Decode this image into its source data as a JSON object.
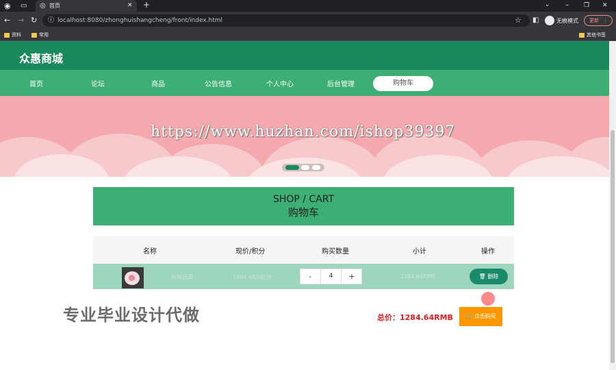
{
  "browser": {
    "tab_title": "首页",
    "url": "localhost:8080/zhonghuishangcheng/front/index.html",
    "profile_label": "无痕模式",
    "update_label": "更新",
    "bookmarks": [
      "资料",
      "常用"
    ],
    "other_bookmarks": "其他书签"
  },
  "site": {
    "title": "众惠商城",
    "nav": [
      "首页",
      "论坛",
      "商品",
      "公告信息",
      "个人中心",
      "后台管理",
      "购物车"
    ]
  },
  "watermark_url": "https://www.huzhan.com/ishop39397",
  "cart": {
    "title_en": "SHOP / CART",
    "title_cn": "购物车",
    "columns": [
      "名称",
      "现价/积分",
      "购买数量",
      "小计",
      "操作"
    ],
    "rows": [
      {
        "name": "新鲜蔬菜",
        "price": "1284.64/0积分",
        "quantity": "4",
        "subtotal": "1284.64RMB",
        "action": "删除"
      }
    ],
    "minus": "-",
    "plus": "+",
    "total_label": "总价：1284.64RMB",
    "buy_label": "点击购买"
  },
  "promo_text": "专业毕业设计代做",
  "colors": {
    "header": "#1a8a5c",
    "nav": "#3dae74",
    "banner": "#f5a8ad",
    "buy": "#ff9800",
    "total": "#e02020"
  }
}
